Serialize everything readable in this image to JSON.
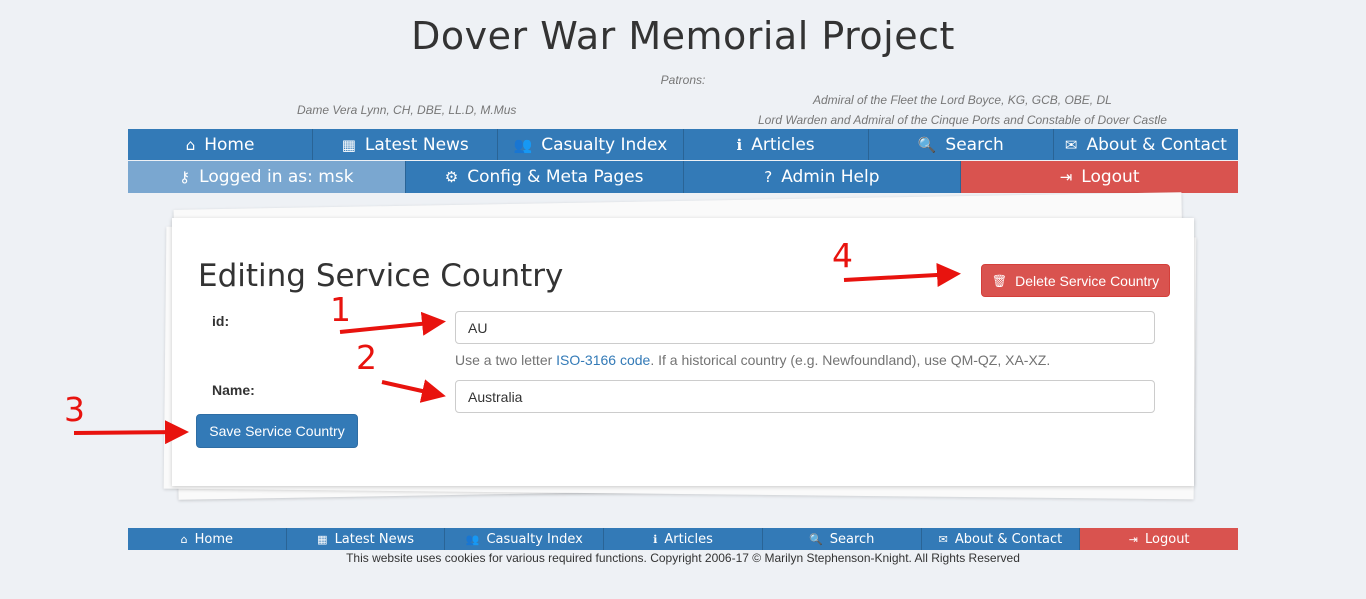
{
  "header": {
    "title": "Dover War Memorial Project",
    "patrons_label": "Patrons:",
    "patron_left": "Dame Vera Lynn, CH, DBE, LL.D, M.Mus",
    "patron_right_line1": "Admiral of the Fleet the Lord Boyce, KG, GCB, OBE, DL",
    "patron_right_line2": "Lord Warden and Admiral of the Cinque Ports and Constable of Dover Castle"
  },
  "nav_main": [
    {
      "label": "Home",
      "icon": "home-icon",
      "glyph": "⌂"
    },
    {
      "label": "Latest News",
      "icon": "calendar-icon",
      "glyph": "▦"
    },
    {
      "label": "Casualty Index",
      "icon": "users-icon",
      "glyph": "👥"
    },
    {
      "label": "Articles",
      "icon": "info-icon",
      "glyph": "ℹ"
    },
    {
      "label": "Search",
      "icon": "search-icon",
      "glyph": "🔍"
    },
    {
      "label": "About & Contact",
      "icon": "envelope-icon",
      "glyph": "✉"
    }
  ],
  "nav_admin": [
    {
      "label": "Logged in as: msk",
      "icon": "key-icon",
      "glyph": "⚷"
    },
    {
      "label": "Config & Meta Pages",
      "icon": "cogs-icon",
      "glyph": "⚙"
    },
    {
      "label": "Admin Help",
      "icon": "question-icon",
      "glyph": "?"
    },
    {
      "label": "Logout",
      "icon": "logout-icon",
      "glyph": "⇥"
    }
  ],
  "form": {
    "title": "Editing Service Country",
    "delete_label": "Delete Service Country",
    "id_label": "id:",
    "id_value": "AU",
    "help_prefix": "Use a two letter ",
    "help_link": "ISO-3166 code",
    "help_suffix": ". If a historical country (e.g. Newfoundland), use QM-QZ, XA-XZ.",
    "name_label": "Name:",
    "name_value": "Australia",
    "save_label": "Save Service Country"
  },
  "annotations": {
    "one": "1",
    "two": "2",
    "three": "3",
    "four": "4",
    "color": "#e8130e"
  },
  "footer_nav": [
    {
      "label": "Home",
      "icon": "home-icon",
      "glyph": "⌂"
    },
    {
      "label": "Latest News",
      "icon": "calendar-icon",
      "glyph": "▦"
    },
    {
      "label": "Casualty Index",
      "icon": "users-icon",
      "glyph": "👥"
    },
    {
      "label": "Articles",
      "icon": "info-icon",
      "glyph": "ℹ"
    },
    {
      "label": "Search",
      "icon": "search-icon",
      "glyph": "🔍"
    },
    {
      "label": "About & Contact",
      "icon": "envelope-icon",
      "glyph": "✉"
    },
    {
      "label": "Logout",
      "icon": "logout-icon",
      "glyph": "⇥"
    }
  ],
  "copyright": "This website uses cookies for various required functions. Copyright 2006-17 © Marilyn Stephenson-Knight. All Rights Reserved",
  "colors": {
    "primary": "#337ab7",
    "danger": "#d9534f",
    "logged_in": "#7aa7d0",
    "background": "#eef1f5"
  }
}
